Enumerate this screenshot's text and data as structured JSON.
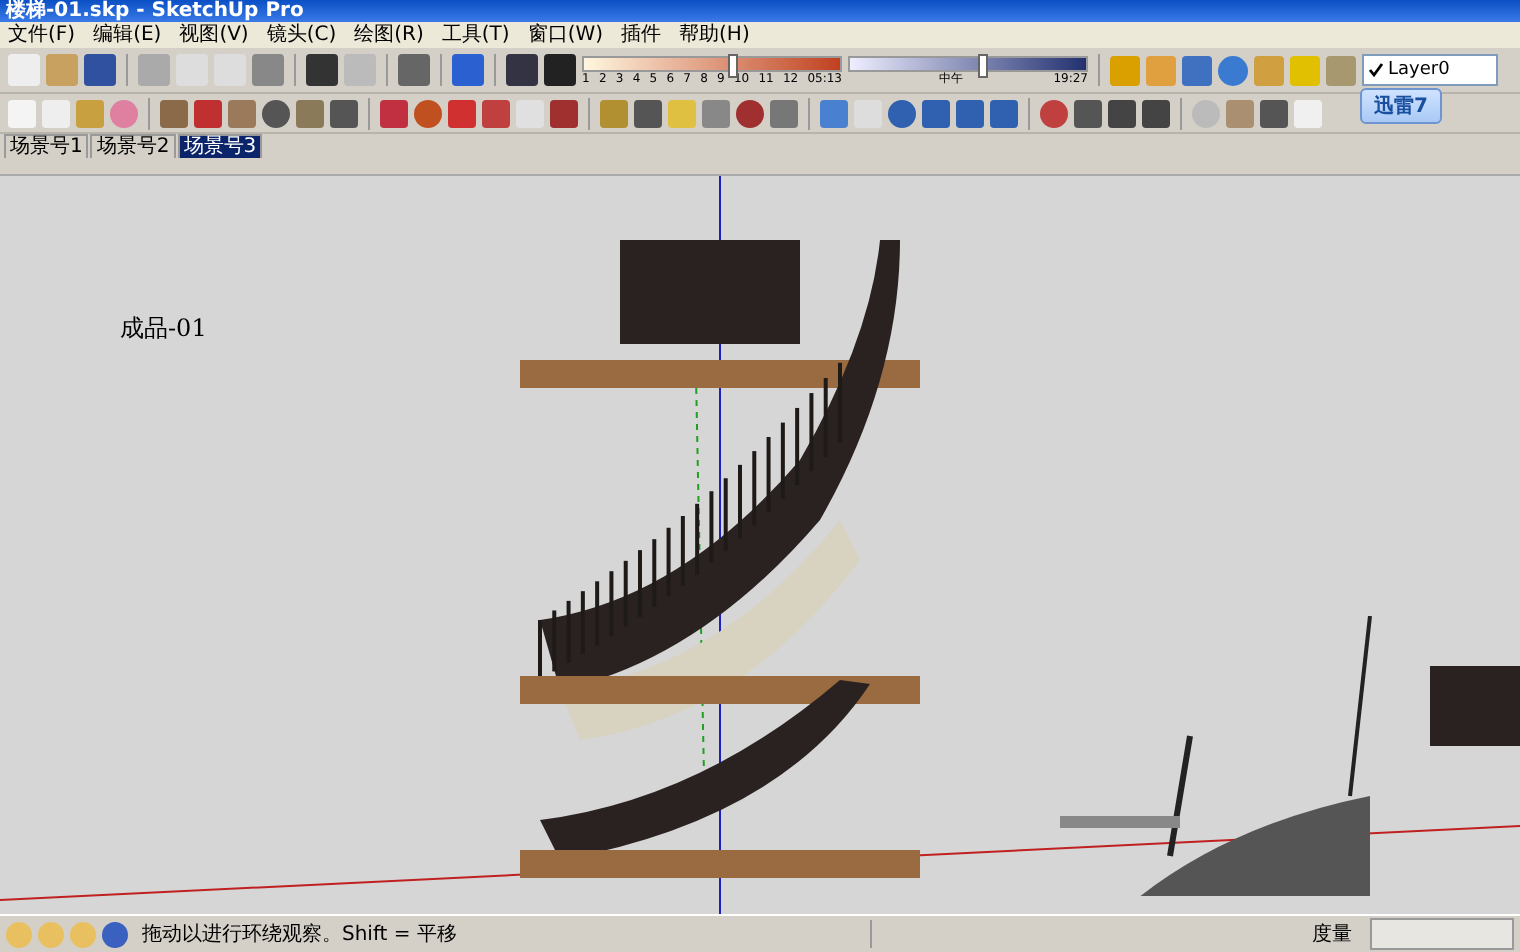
{
  "window": {
    "title": "楼梯-01.skp - SketchUp Pro"
  },
  "menu": [
    "文件(F)",
    "编辑(E)",
    "视图(V)",
    "镜头(C)",
    "绘图(R)",
    "工具(T)",
    "窗口(W)",
    "插件",
    "帮助(H)"
  ],
  "shadow_settings": {
    "month_ticks": [
      "1",
      "2",
      "3",
      "4",
      "5",
      "6",
      "7",
      "8",
      "9",
      "10",
      "11",
      "12"
    ],
    "month_slider": {
      "level": 0.58
    },
    "time_start": "05:13",
    "time_mid": "中午",
    "time_end": "19:27",
    "time_slider": {
      "level": 0.56
    }
  },
  "layer_select": {
    "value": "Layer0",
    "checked": true
  },
  "floating_badge": {
    "label": "迅雷7"
  },
  "scene_tabs": [
    {
      "label": "场景号1",
      "selected": false
    },
    {
      "label": "场景号2",
      "selected": false
    },
    {
      "label": "场景号3",
      "selected": true
    }
  ],
  "canvas": {
    "label": "成品-01"
  },
  "status_bar": {
    "hint": "拖动以进行环绕观察。Shift = 平移",
    "measure_label": "度量"
  }
}
